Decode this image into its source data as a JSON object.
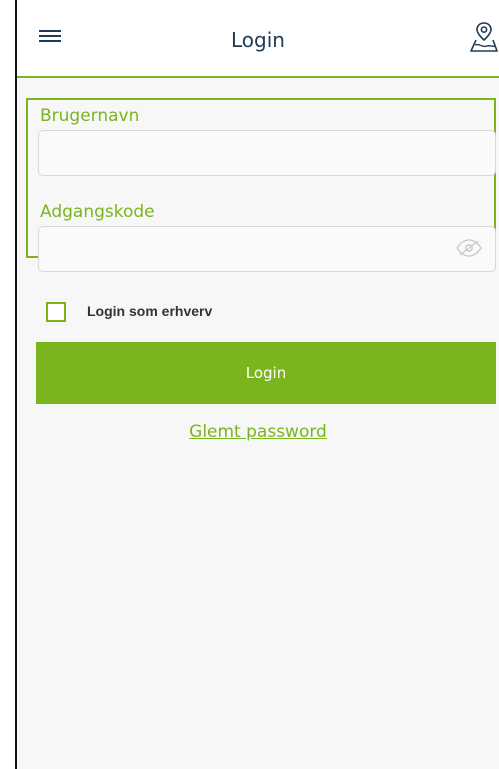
{
  "header": {
    "title": "Login",
    "menu_icon": "hamburger-menu-icon",
    "map_icon": "map-pin-icon"
  },
  "form": {
    "username_label": "Brugernavn",
    "username_value": "",
    "password_label": "Adgangskode",
    "password_value": "",
    "password_toggle_icon": "eye-icon"
  },
  "checkbox": {
    "label": "Login som erhverv",
    "checked": false
  },
  "actions": {
    "login_label": "Login",
    "forgot_label": "Glemt password"
  },
  "colors": {
    "accent": "#7ab51d",
    "title": "#1f3b57",
    "background": "#f7f7f7"
  }
}
